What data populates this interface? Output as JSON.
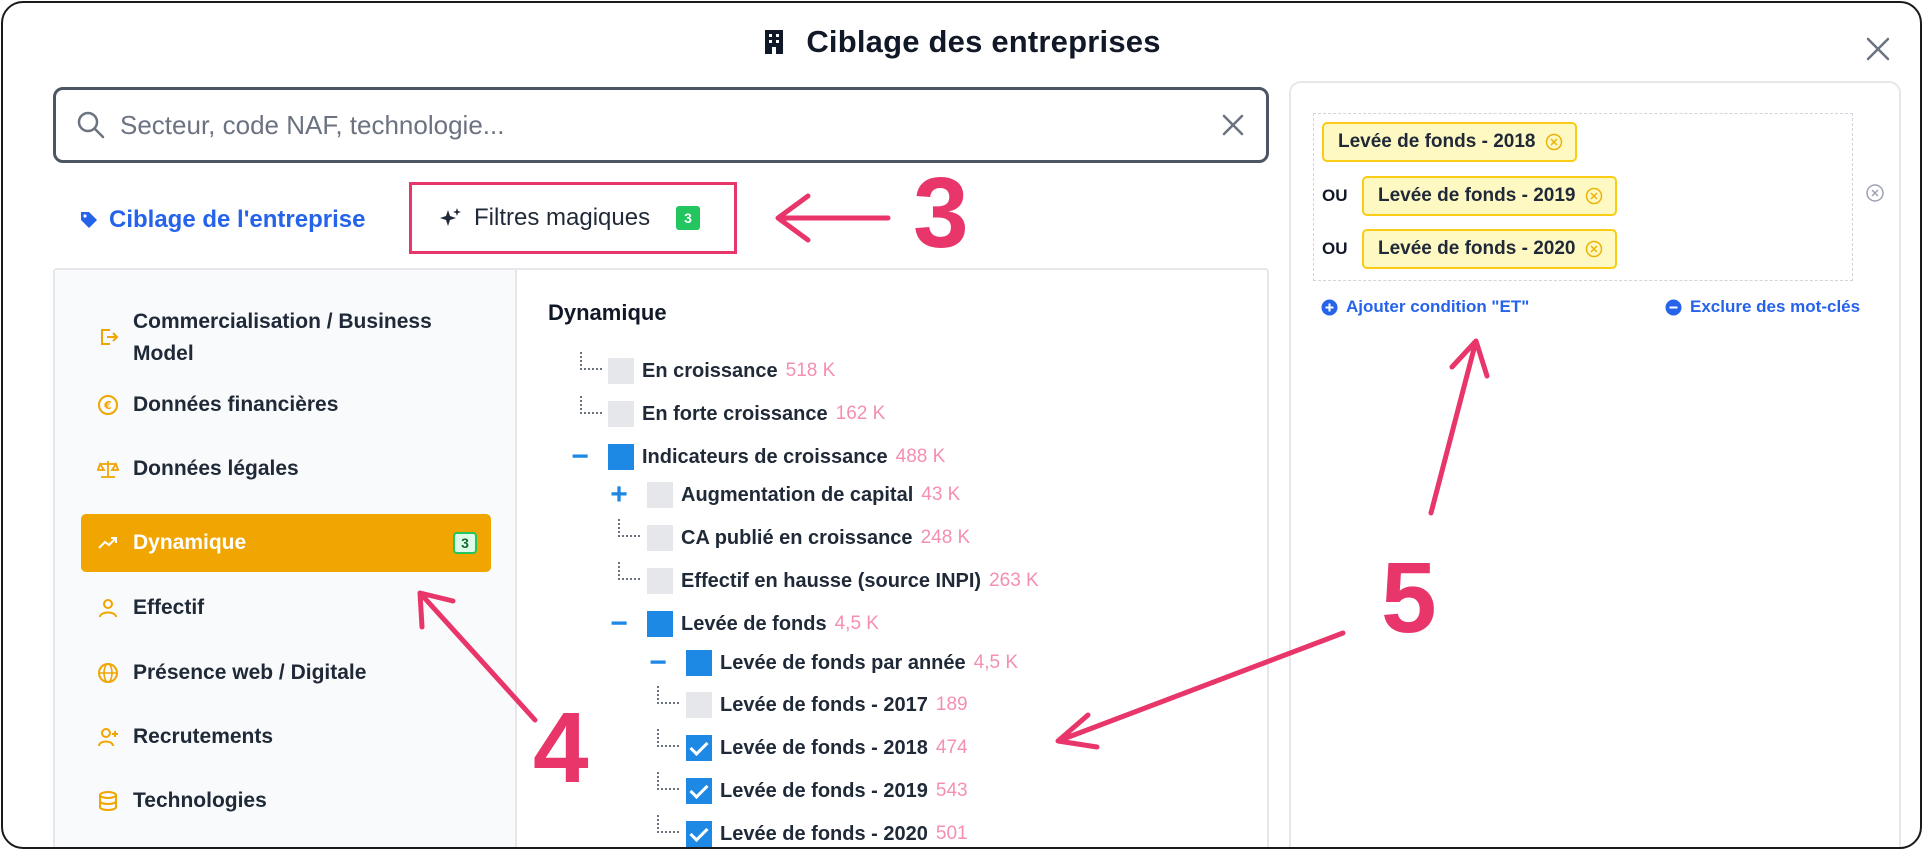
{
  "header": {
    "title": "Ciblage des entreprises"
  },
  "search": {
    "placeholder": "Secteur, code NAF, technologie..."
  },
  "tabs": {
    "company": "Ciblage de l'entreprise",
    "magic": "Filtres magiques",
    "magic_count": "3"
  },
  "annotations": {
    "n3": "3",
    "n4": "4",
    "n5": "5"
  },
  "sidebar": {
    "items": [
      {
        "label": "Commercialisation / Business Model",
        "icon": "exit-icon"
      },
      {
        "label": "Données financières",
        "icon": "euro-icon"
      },
      {
        "label": "Données légales",
        "icon": "scale-icon"
      },
      {
        "label": "Dynamique",
        "icon": "trend-up-icon",
        "active": true,
        "count": "3"
      },
      {
        "label": "Effectif",
        "icon": "person-icon"
      },
      {
        "label": "Présence web / Digitale",
        "icon": "globe-icon"
      },
      {
        "label": "Recrutements",
        "icon": "person-add-icon"
      },
      {
        "label": "Technologies",
        "icon": "database-icon"
      }
    ]
  },
  "tree": {
    "title": "Dynamique",
    "nodes": [
      {
        "label": "En croissance",
        "count": "518 K",
        "state": "unchecked"
      },
      {
        "label": "En forte croissance",
        "count": "162 K",
        "state": "unchecked"
      },
      {
        "label": "Indicateurs de croissance",
        "count": "488 K",
        "state": "partial",
        "toggle": "−"
      },
      {
        "label": "Augmentation de capital",
        "count": "43 K",
        "state": "unchecked",
        "toggle": "+"
      },
      {
        "label": "CA publié en croissance",
        "count": "248 K",
        "state": "unchecked"
      },
      {
        "label": "Effectif en hausse (source INPI)",
        "count": "263 K",
        "state": "unchecked"
      },
      {
        "label": "Levée de fonds",
        "count": "4,5 K",
        "state": "partial",
        "toggle": "−"
      },
      {
        "label": "Levée de fonds par année",
        "count": "4,5 K",
        "state": "partial",
        "toggle": "−"
      },
      {
        "label": "Levée de fonds - 2017",
        "count": "189",
        "state": "unchecked"
      },
      {
        "label": "Levée de fonds - 2018",
        "count": "474",
        "state": "checked"
      },
      {
        "label": "Levée de fonds - 2019",
        "count": "543",
        "state": "checked"
      },
      {
        "label": "Levée de fonds - 2020",
        "count": "501",
        "state": "checked"
      }
    ]
  },
  "conditions": {
    "rows": [
      {
        "op": "",
        "chip": "Levée de fonds - 2018"
      },
      {
        "op": "OU",
        "chip": "Levée de fonds - 2019"
      },
      {
        "op": "OU",
        "chip": "Levée de fonds - 2020"
      }
    ],
    "add_and": "Ajouter condition \"ET\"",
    "exclude": "Exclure des mot-clés"
  },
  "colors": {
    "accent": "#2563eb",
    "active": "#f0a500",
    "annotation": "#e8356a",
    "chip_bg": "#fef9c3",
    "count": "#f48fb1",
    "checkbox": "#1e88e5"
  }
}
